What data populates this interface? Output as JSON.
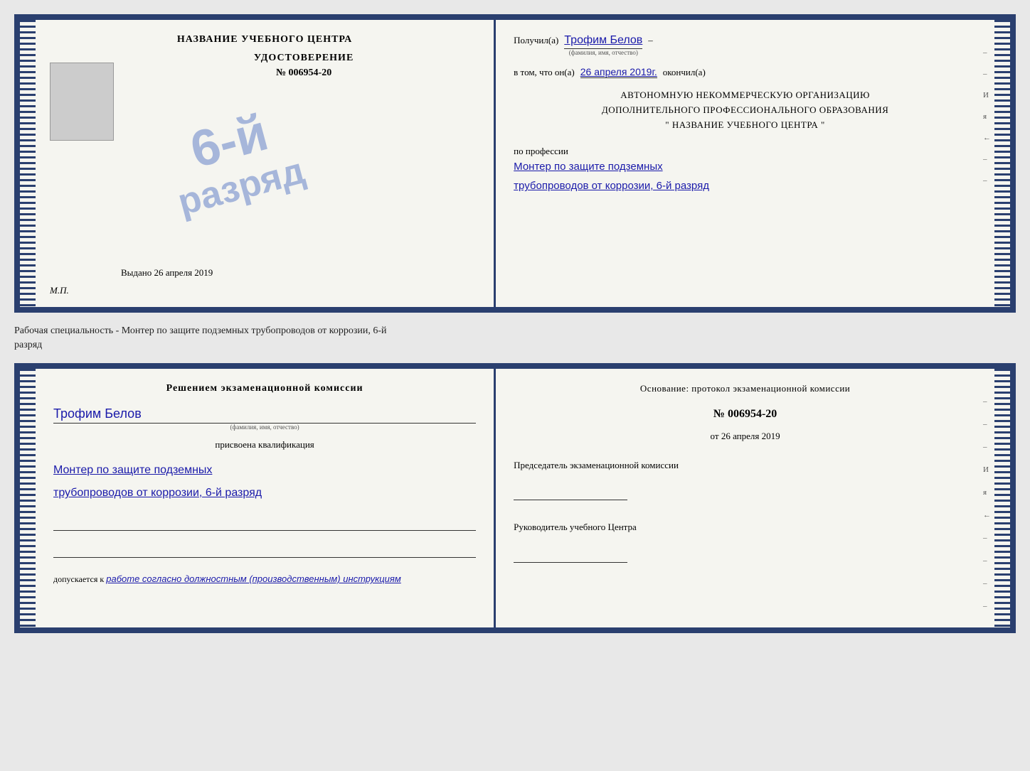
{
  "top_cert": {
    "left": {
      "title": "НАЗВАНИЕ УЧЕБНОГО ЦЕНТРА",
      "udost": "УДОСТОВЕРЕНИЕ",
      "number": "№ 006954-20",
      "stamp_line1": "6-й",
      "stamp_line2": "разряд",
      "vydano_label": "Выдано",
      "vydano_date": "26 апреля 2019",
      "mp": "М.П."
    },
    "right": {
      "poluchil_label": "Получил(а)",
      "poluchil_name": "Трофим Белов",
      "fio_hint": "(фамилия, имя, отчество)",
      "vtom_label": "в том, что он(а)",
      "vtom_date": "26 апреля 2019г.",
      "okончил_label": "окончил(а)",
      "org_line1": "АВТОНОМНУЮ НЕКОММЕРЧЕСКУЮ ОРГАНИЗАЦИЮ",
      "org_line2": "ДОПОЛНИТЕЛЬНОГО ПРОФЕССИОНАЛЬНОГО ОБРАЗОВАНИЯ",
      "org_line3": "\"  НАЗВАНИЕ УЧЕБНОГО ЦЕНТРА  \"",
      "po_professii": "по профессии",
      "profession_line1": "Монтер по защите подземных",
      "profession_line2": "трубопроводов от коррозии, 6-й разряд",
      "side_chars": [
        "–",
        "–",
        "И",
        "я",
        "←",
        "–",
        "–",
        "–"
      ]
    }
  },
  "label": {
    "text_line1": "Рабочая специальность - Монтер по защите подземных трубопроводов от коррозии, 6-й",
    "text_line2": "разряд"
  },
  "bottom_cert": {
    "left": {
      "decision_title": "Решением экзаменационной комиссии",
      "person_name": "Трофим Белов",
      "fio_hint": "(фамилия, имя, отчество)",
      "prisvoena": "присвоена квалификация",
      "qual_line1": "Монтер по защите подземных",
      "qual_line2": "трубопроводов от коррозии, 6-й разряд",
      "dopuskaetsya_label": "допускается к",
      "dopuskaetsya_text": "работе согласно должностным (производственным) инструкциям"
    },
    "right": {
      "osnovanie_title": "Основание: протокол экзаменационной комиссии",
      "number": "№  006954-20",
      "ot_label": "от",
      "ot_date": "26 апреля 2019",
      "predsedatel_title": "Председатель экзаменационной комиссии",
      "rukovoditel_title": "Руководитель учебного Центра",
      "side_chars": [
        "–",
        "–",
        "–",
        "И",
        "я",
        "←",
        "–",
        "–",
        "–",
        "–"
      ]
    }
  }
}
